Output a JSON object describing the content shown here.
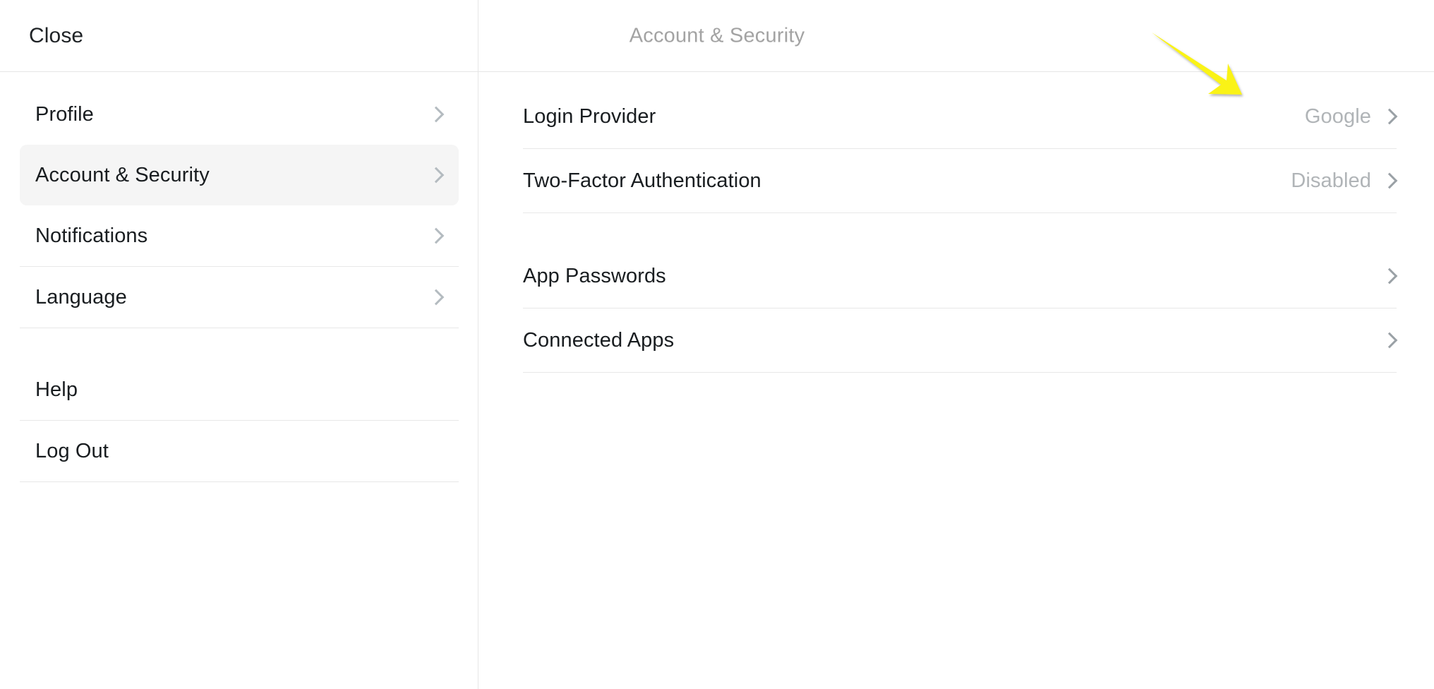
{
  "header": {
    "close_label": "Close",
    "title": "Account & Security"
  },
  "sidebar": {
    "items": [
      {
        "label": "Profile",
        "chevron": "chevron-right-icon",
        "active": false
      },
      {
        "label": "Account & Security",
        "chevron": "chevron-right-icon",
        "active": true
      },
      {
        "label": "Notifications",
        "chevron": "chevron-right-icon",
        "active": false
      },
      {
        "label": "Language",
        "chevron": "chevron-right-icon",
        "active": false
      },
      {
        "label": "Help",
        "chevron": "",
        "active": false
      },
      {
        "label": "Log Out",
        "chevron": "",
        "active": false
      }
    ]
  },
  "main": {
    "rows": [
      {
        "label": "Login Provider",
        "value": "Google",
        "chevron": "chevron-right-icon"
      },
      {
        "label": "Two-Factor Authentication",
        "value": "Disabled",
        "chevron": "chevron-right-icon"
      },
      {
        "label": "App Passwords",
        "value": "",
        "chevron": "chevron-right-icon"
      },
      {
        "label": "Connected Apps",
        "value": "",
        "chevron": "chevron-right-icon"
      }
    ]
  },
  "annotation": {
    "name": "yellow-arrow-pointer",
    "color": "#FAF312",
    "points_to": "Login Provider value"
  },
  "colors": {
    "background": "#ffffff",
    "text_primary": "#191d20",
    "text_muted": "#b0b4b7",
    "title_muted": "#a3a3a3",
    "divider": "#e8e8e8",
    "active_row_bg": "#f5f5f5",
    "chevron": "#9aa1a6",
    "annotation_yellow": "#FAF312"
  }
}
